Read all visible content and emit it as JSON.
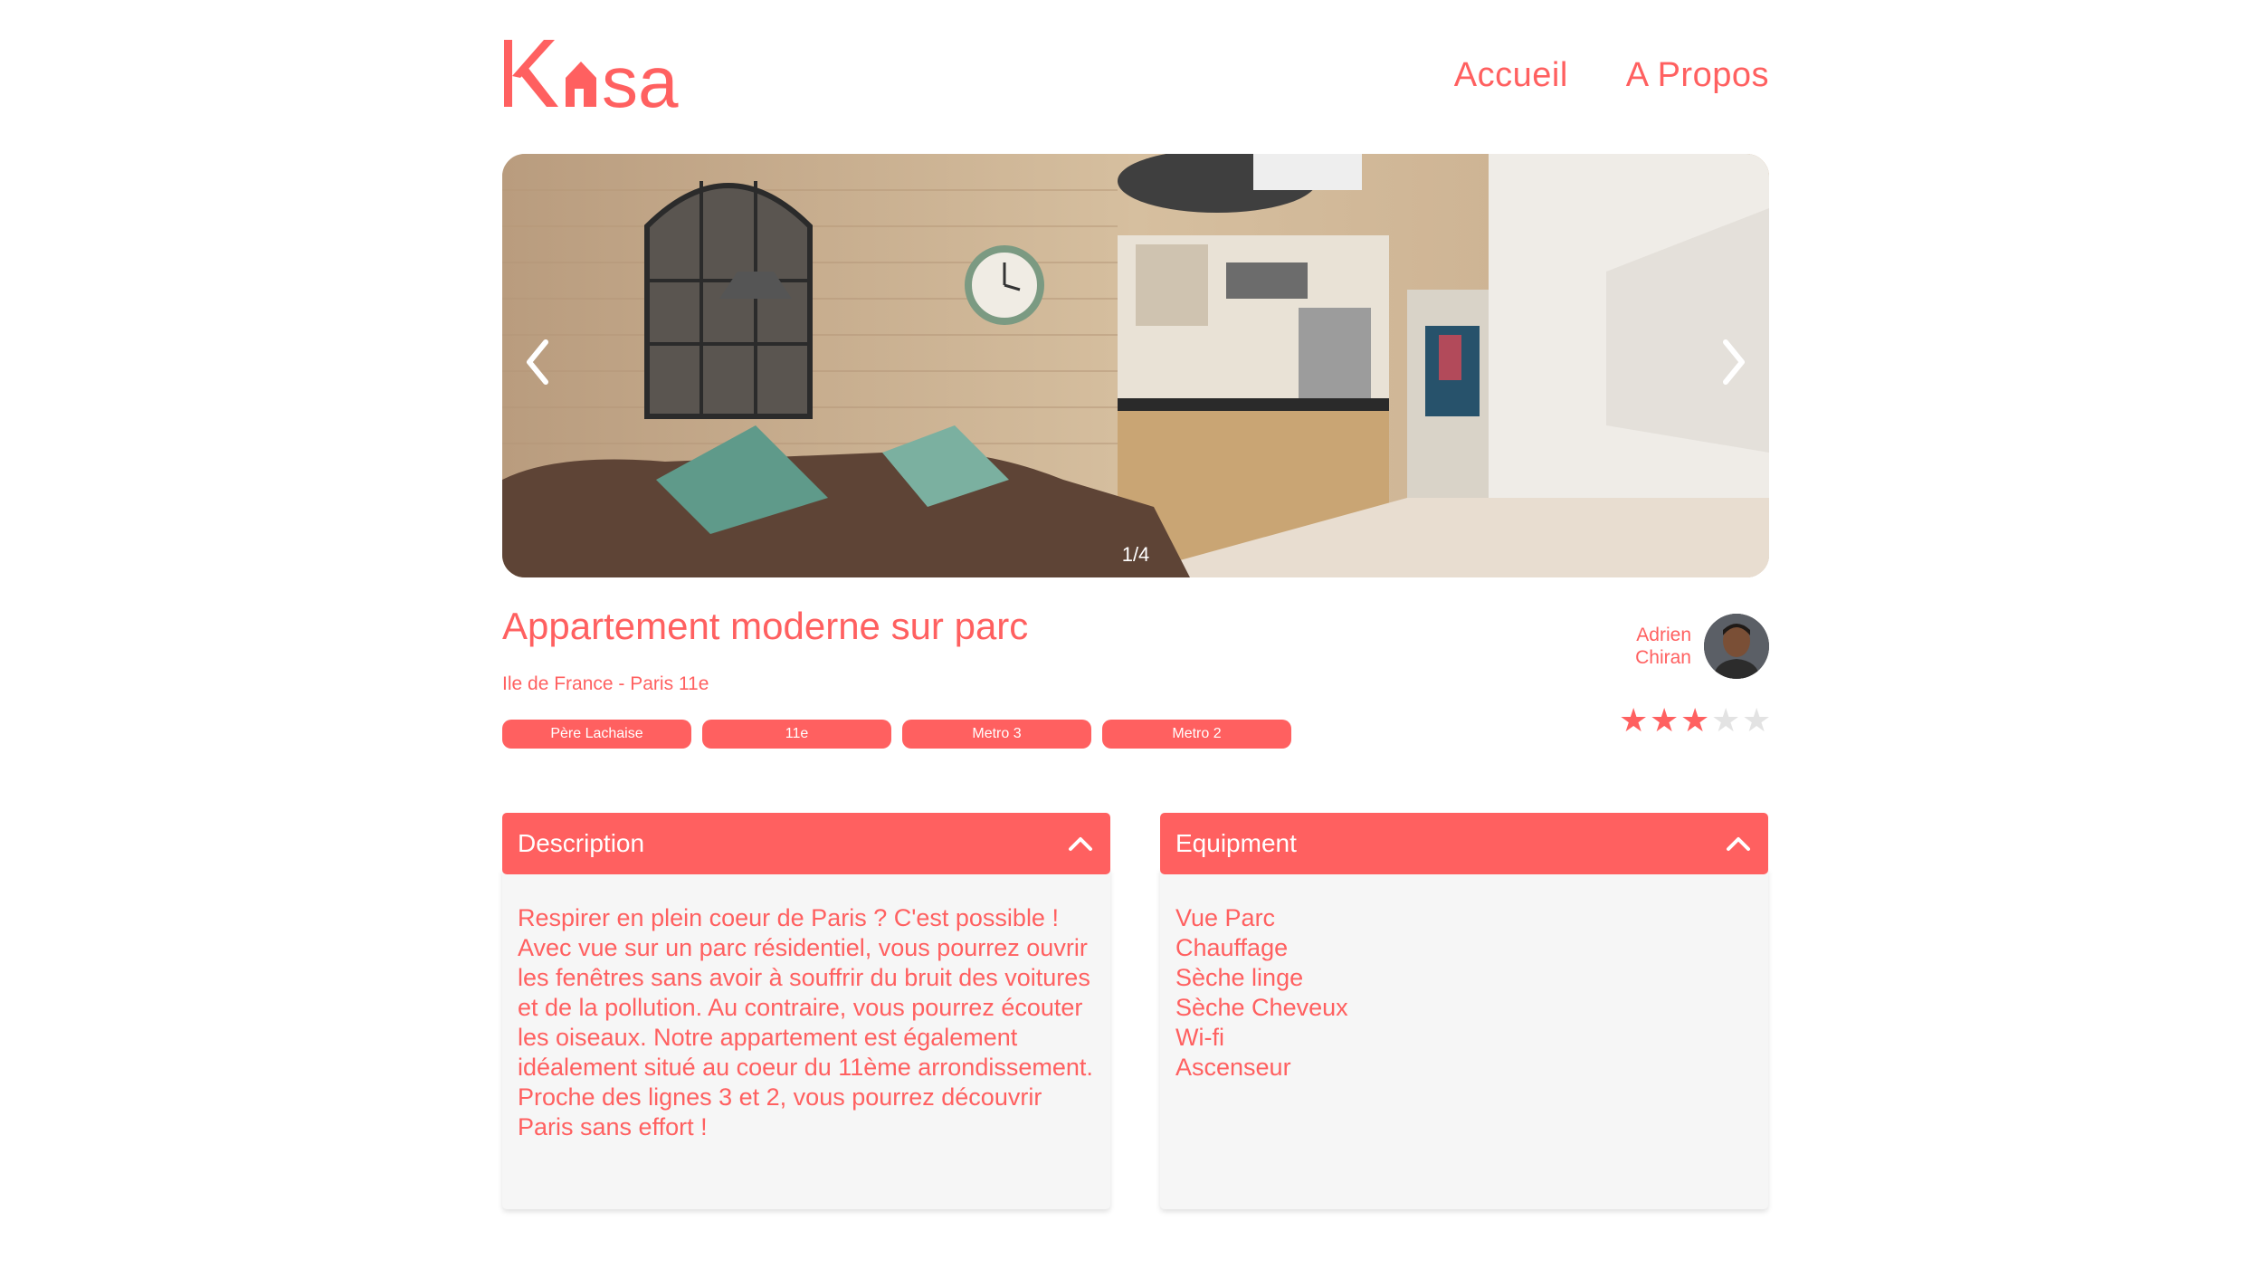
{
  "header": {
    "logo_text": "Kasa",
    "nav": [
      {
        "label": "Accueil"
      },
      {
        "label": "A Propos"
      }
    ]
  },
  "gallery": {
    "counter": "1/4",
    "icons": {
      "prev": "chevron-left-icon",
      "next": "chevron-right-icon"
    }
  },
  "listing": {
    "title": "Appartement moderne sur parc",
    "location": "Ile de France - Paris 11e",
    "tags": [
      "Père Lachaise",
      "11e",
      "Metro 3",
      "Metro 2"
    ]
  },
  "host": {
    "first_name": "Adrien",
    "last_name": "Chiran"
  },
  "rating": {
    "value": 3,
    "max": 5,
    "filled_color": "#FF6060",
    "empty_color": "#E3E3E3"
  },
  "description": {
    "title": "Description",
    "text": "Respirer en plein coeur de Paris ? C'est possible ! Avec vue sur un parc résidentiel, vous pourrez ouvrir les fenêtres sans avoir à souffrir du bruit des voitures et de la pollution. Au contraire, vous pourrez écouter les oiseaux. Notre appartement est également idéalement situé au coeur du 11ème arrondissement. Proche des lignes 3 et 2, vous pourrez découvrir Paris sans effort !"
  },
  "equipment": {
    "title": "Equipment",
    "items": [
      "Vue Parc",
      "Chauffage",
      "Sèche linge",
      "Sèche Cheveux",
      "Wi-fi",
      "Ascenseur"
    ]
  },
  "colors": {
    "accent": "#FF6060",
    "panel_bg": "#F6F6F6",
    "white": "#FFFFFF"
  }
}
